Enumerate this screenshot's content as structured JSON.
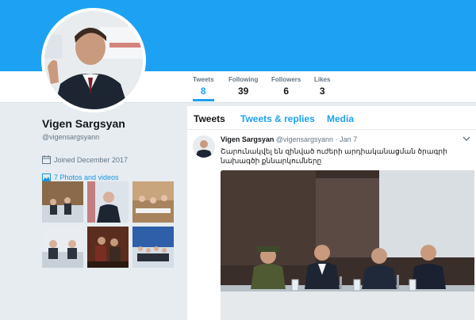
{
  "profile": {
    "name": "Vigen Sargsyan",
    "handle": "@vigensargsyann",
    "joined": "Joined December 2017",
    "photos_link": "7 Photos and videos"
  },
  "stats": [
    {
      "label": "Tweets",
      "value": "8"
    },
    {
      "label": "Following",
      "value": "39"
    },
    {
      "label": "Followers",
      "value": "6"
    },
    {
      "label": "Likes",
      "value": "3"
    }
  ],
  "tabs": [
    {
      "label": "Tweets"
    },
    {
      "label": "Tweets & replies"
    },
    {
      "label": "Media"
    }
  ],
  "tweet": {
    "name": "Vigen Sargsyan",
    "meta": "@vigensargsyann · Jan 7",
    "text": "Շարունակվել են զինված ուժերի արդիականացման ծրագրի նախագծի քննարկումները"
  },
  "colors": {
    "banner": "#1da1f2",
    "accent": "#1da1f2",
    "link": "#1b95e0",
    "page_bg": "#e6ecf0"
  },
  "icons": {
    "joined": "calendar-icon",
    "photos": "image-icon",
    "tweet_menu": "chevron-down-icon"
  }
}
